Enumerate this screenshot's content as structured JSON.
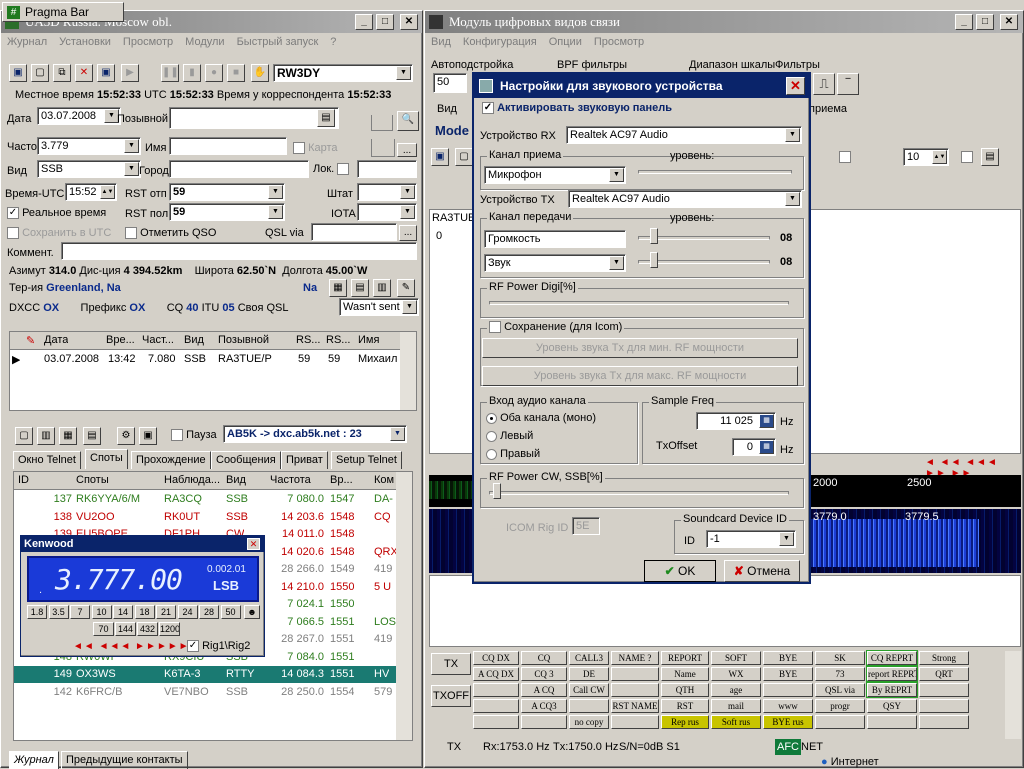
{
  "taskbar": {
    "pragma_bar": "Pragma Bar"
  },
  "log": {
    "title": "UA3D Russia. Moscow obl.",
    "menu": [
      "Журнал",
      "Установки",
      "Просмотр",
      "Модули",
      "Быстрый запуск",
      "?"
    ],
    "callsign": "RW3DY",
    "time": {
      "local_label": "Местное время",
      "local": "15:52:33",
      "utc_label": "UTC",
      "utc": "15:52:33",
      "corr_label": "Время у корреспондента",
      "corr": "15:52:33"
    },
    "date_label": "Дата",
    "date": "03.07.2008",
    "callsign_label": "Позывной",
    "freq_label": "Частота",
    "freq": "3.779",
    "name_label": "Имя",
    "card_label": "Карта",
    "mode_label": "Вид",
    "mode": "SSB",
    "city_label": "Город",
    "loc_label": "Лок.",
    "utc_time_label": "Время-UTC",
    "utc_time": "15:52",
    "rst_sent_label": "RST отп",
    "rst_sent": "59",
    "state_label": "Штат",
    "realtime_label": "Реальное время",
    "rst_rcvd_label": "RST пол",
    "rst_rcvd": "59",
    "iota_label": "IOTA",
    "save_utc_label": "Сохранить в UTC",
    "mark_qso_label": "Отметить QSO",
    "qsl_via_label": "QSL via",
    "comment_label": "Коммент.",
    "azimuth_label": "Азимут",
    "azimuth": "314.0",
    "distance_label": "Дис-ция",
    "distance": "4 394.52km",
    "lat_label": "Широта",
    "lat": "62.50`N",
    "lon_label": "Долгота",
    "lon": "45.00`W",
    "territory_label": "Тер-ия",
    "territory": "Greenland, Na",
    "continent": "Na",
    "dxcc_label": "DXCC",
    "dxcc": "OX",
    "prefix_label": "Префикс",
    "prefix": "OX",
    "cq_label": "CQ",
    "cq": "40",
    "itu_label": "ITU",
    "itu": "05",
    "own_qsl_label": "Своя QSL",
    "own_qsl": "Wasn't sent",
    "qso_table": {
      "headers": [
        "Дата",
        "Вре...",
        "Част...",
        "Вид",
        "Позывной",
        "RS...",
        "RS...",
        "Имя"
      ],
      "rows": [
        [
          "03.07.2008",
          "13:42",
          "7.080",
          "SSB",
          "RA3TUE/P",
          "59",
          "59",
          "Михаил"
        ]
      ]
    },
    "cluster": {
      "pause_label": "Пауза",
      "server": "AB5K -> dxc.ab5k.net : 23"
    },
    "tabs": [
      "Окно Telnet",
      "Споты",
      "Прохождение",
      "Сообщения",
      "Приват",
      "Setup Telnet"
    ],
    "spots": {
      "headers": [
        "ID",
        "Споты",
        "Наблюда...",
        "Вид",
        "Частота",
        "Вр...",
        "Ком"
      ],
      "rows": [
        {
          "id": "137",
          "spot": "RK6YYA/6/M",
          "obs": "RA3CQ",
          "mode": "SSB",
          "freq": "7 080.0",
          "time": "1547",
          "com": "DA-",
          "color": "#2e7d1e"
        },
        {
          "id": "138",
          "spot": "VU2OO",
          "obs": "RK0UT",
          "mode": "SSB",
          "freq": "14 203.6",
          "time": "1548",
          "com": "CQ",
          "color": "#c00000"
        },
        {
          "id": "139",
          "spot": "EU5BOPE",
          "obs": "DF1PH",
          "mode": "CW",
          "freq": "14 011.0",
          "time": "1548",
          "com": "",
          "color": "#c00000"
        },
        {
          "id": "",
          "spot": "",
          "obs": "",
          "mode": "",
          "freq": "14 020.6",
          "time": "1548",
          "com": "QRX",
          "color": "#c00000"
        },
        {
          "id": "",
          "spot": "",
          "obs": "",
          "mode": "",
          "freq": "28 266.0",
          "time": "1549",
          "com": "419",
          "color": "#808080"
        },
        {
          "id": "",
          "spot": "",
          "obs": "",
          "mode": "",
          "freq": "14 210.0",
          "time": "1550",
          "com": "5 U",
          "color": "#c00000"
        },
        {
          "id": "",
          "spot": "",
          "obs": "",
          "mode": "",
          "freq": "7 024.1",
          "time": "1550",
          "com": "",
          "color": "#2e7d1e"
        },
        {
          "id": "",
          "spot": "",
          "obs": "",
          "mode": "",
          "freq": "7 066.5",
          "time": "1551",
          "com": "LOS",
          "color": "#2e7d1e"
        },
        {
          "id": "",
          "spot": "",
          "obs": "",
          "mode": "",
          "freq": "28 267.0",
          "time": "1551",
          "com": "419",
          "color": "#808080"
        },
        {
          "id": "148",
          "spot": "RW0WF",
          "obs": "RX9CIU",
          "mode": "SSB",
          "freq": "7 084.0",
          "time": "1551",
          "com": "",
          "color": "#2e7d1e"
        },
        {
          "id": "149",
          "spot": "OX3WS",
          "obs": "K6TA-3",
          "mode": "RTTY",
          "freq": "14 084.3",
          "time": "1551",
          "com": "HV",
          "color": "#ffffff"
        },
        {
          "id": "142",
          "spot": "K6FRC/B",
          "obs": "VE7NBO",
          "mode": "SSB",
          "freq": "28 250.0",
          "time": "1554",
          "com": "579",
          "color": "#808080"
        }
      ]
    },
    "bottom_tabs": [
      "Журнал",
      "Предыдущие контакты"
    ]
  },
  "kenwood": {
    "title": "Kenwood",
    "freq": "3.777.00",
    "sub": "0.002.01",
    "mode": "LSB",
    "bands": [
      "1.8",
      "3.5",
      "7",
      "10",
      "14",
      "18",
      "21",
      "24",
      "28",
      "50"
    ],
    "bands2": [
      "70",
      "144",
      "432",
      "1200"
    ],
    "rig_label": "Rig1\\Rig2"
  },
  "digi": {
    "title": "Модуль цифровых видов связи",
    "menu": [
      "Вид",
      "Конфигурация",
      "Опции",
      "Просмотр"
    ],
    "autoadjust_label": "Автоподстройка",
    "autoadjust": "50",
    "bpf_label": "BPF фильтры",
    "scale_label": "Диапазон шкалы",
    "filters_label": "Фильтры",
    "view_label": "Вид",
    "reception": "приема",
    "mode_btn": "Mode",
    "count": "10",
    "ra3tue": "RA3TUE",
    "zero": "0",
    "wf_2000": "2000",
    "wf_2500": "2500",
    "wf_3779_0": "3779.0",
    "wf_3779_5": "3779.5",
    "tx": "TX",
    "txoff": "TXOFF",
    "macros": [
      [
        "CQ DX",
        "CQ",
        "CALL3",
        "NAME ?",
        "REPORT",
        "SOFT",
        "BYE",
        "SK",
        "CQ REPRT",
        "Strong"
      ],
      [
        "A CQ DX",
        "CQ 3",
        "DE",
        "",
        "Name",
        "WX",
        "BYE",
        "73",
        "report REPRT",
        "QRT"
      ],
      [
        "",
        "A CQ",
        "Call CW",
        "",
        "QTH",
        "age",
        "",
        "QSL via",
        "By REPRT",
        ""
      ],
      [
        "",
        "A CQ3",
        "",
        "RST NAME",
        "RST",
        "mail",
        "www",
        "progr",
        "QSY",
        ""
      ],
      [
        "",
        "",
        "no copy",
        "",
        "Rep rus",
        "Soft rus",
        "BYE rus",
        "",
        "",
        ""
      ]
    ],
    "status": {
      "tx": "TX",
      "rx": "Rx:1753.0 Hz",
      "txhz": "Tx:1750.0 Hz",
      "sn": "S/N=0dB S1",
      "afc": "AFC",
      "net": "NET"
    },
    "internet": "Интернет"
  },
  "dialog": {
    "title": "Настройки для звукового устройства",
    "activate": "Активировать звуковую панель",
    "rx_device_label": "Устройство RX",
    "rx_device": "Realtek AC97 Audio",
    "rx_channel_label": "Канал приема",
    "level_label": "уровень:",
    "rx_channel": "Микрофон",
    "tx_device_label": "Устройство TX",
    "tx_device": "Realtek AC97 Audio",
    "tx_channel_label": "Канал передачи",
    "level2_label": "уровень:",
    "tx_ch1": "Громкость",
    "tx_ch1_val": "08",
    "tx_ch2": "Звук",
    "tx_ch2_val": "08",
    "rf_digi": "RF Power Digi[%]",
    "save_icom": "Сохранение (для Icom)",
    "min_rf": "Уровень звука Tx для мин. RF мощности",
    "max_rf": "Уровень звука Tx для макс. RF мощности",
    "audio_input": "Вход аудио канала",
    "both": "Оба канала (моно)",
    "left": "Левый",
    "right": "Правый",
    "sample_freq": "Sample Freq",
    "sample": "11 025",
    "hz": "Hz",
    "txoffset_label": "TxOffset",
    "txoffset": "0",
    "hz2": "Hz",
    "rf_cw": "RF Power CW, SSB[%]",
    "icom_rig": "ICOM Rig ID",
    "icom_val": "5E",
    "soundcard": "Soundcard Device ID",
    "id_label": "ID",
    "id_val": "-1",
    "ok": "OK",
    "cancel": "Отмена"
  }
}
